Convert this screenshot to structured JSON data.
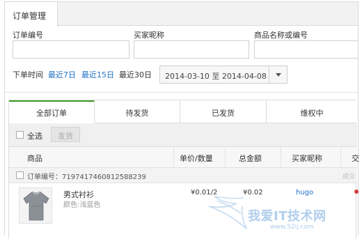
{
  "tab": {
    "label": "订单管理"
  },
  "filters": {
    "order_no_label": "订单编号",
    "buyer_label": "买家昵称",
    "product_label": "商品名称或编号",
    "order_no_value": "",
    "buyer_value": "",
    "product_value": ""
  },
  "time_filter": {
    "label": "下单时间",
    "options": [
      "最近7日",
      "最近15日",
      "最近30日"
    ],
    "selected": "最近30日",
    "range": "2014-03-10 至 2014-04-08"
  },
  "order_tabs": [
    "全部订单",
    "待发货",
    "已发货",
    "维权中"
  ],
  "toolbar": {
    "select_all": "全选",
    "ship": "发货"
  },
  "columns": [
    "商品",
    "单价/数量",
    "总金额",
    "买家昵称",
    "交"
  ],
  "order": {
    "number_text": "订单编号：7197417460812588239",
    "status": "成交",
    "product_name": "男式衬衫",
    "product_attr": "颜色:浅蓝色",
    "price_qty": "¥0.01/2",
    "total": "¥0.02",
    "buyer": "hugo"
  },
  "watermark": {
    "text": "我爱IT技术网",
    "sub": "www.52ij.com"
  },
  "colors": {
    "link": "#1d6fc4",
    "active_tab": "#3e9a2a",
    "flag": "#d83a3a"
  }
}
